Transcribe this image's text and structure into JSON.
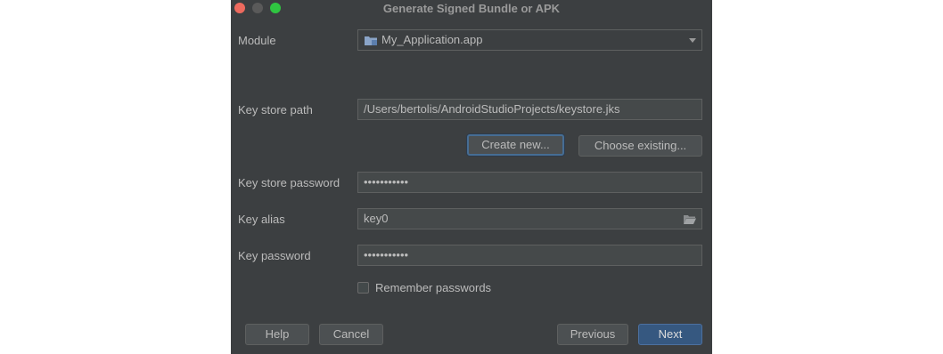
{
  "window": {
    "title": "Generate Signed Bundle or APK"
  },
  "module": {
    "label": "Module",
    "value": "My_Application.app"
  },
  "keystore_path": {
    "label": "Key store path",
    "value": "/Users/bertolis/AndroidStudioProjects/keystore.jks"
  },
  "keystore_buttons": {
    "create_new": "Create new...",
    "choose_existing": "Choose existing..."
  },
  "keystore_password": {
    "label": "Key store password",
    "value": "•••••••••••"
  },
  "key_alias": {
    "label": "Key alias",
    "value": "key0"
  },
  "key_password": {
    "label": "Key password",
    "value": "•••••••••••"
  },
  "remember": {
    "label": "Remember passwords",
    "checked": false
  },
  "footer": {
    "help": "Help",
    "cancel": "Cancel",
    "previous": "Previous",
    "next": "Next"
  },
  "colors": {
    "dialog_bg": "#3c3f41",
    "field_bg": "#45494a",
    "default_button": "#365880",
    "close": "#ed6a5e",
    "maximize": "#2fc541"
  }
}
